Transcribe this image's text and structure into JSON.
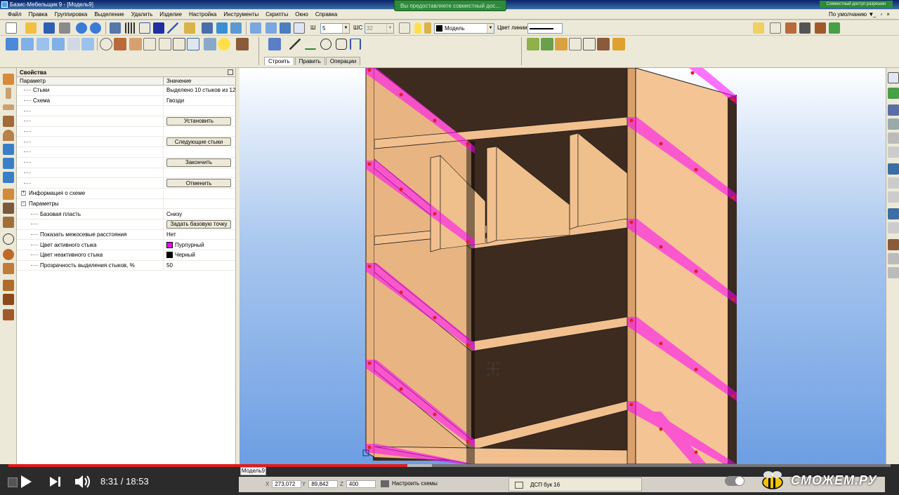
{
  "window": {
    "title": "Базис-Мебельщик 9 - [Модель9]",
    "share_banner": "Вы предоставляете совместный дос...",
    "share_right": "Совместный доступ разрешен",
    "profile": "По умолчанию",
    "profile_caret": "▼",
    "controls": [
      "_",
      "▫",
      "×"
    ]
  },
  "menu": [
    "Файл",
    "Правка",
    "Группировка",
    "Выделение",
    "Удалить",
    "Изделие",
    "Настройка",
    "Инструменты",
    "Скрипты",
    "Окно",
    "Справка"
  ],
  "toolbar": {
    "w_label": "Ш",
    "w_value": "5",
    "ws_label": "ШС",
    "ws_value": "32",
    "layer_name": "Модель",
    "line_color_label": "Цвет линии"
  },
  "mode_tabs": [
    "Строить",
    "Править",
    "Операции"
  ],
  "properties": {
    "title": "Свойства",
    "col_param": "Параметр",
    "col_value": "Значение",
    "rows": [
      {
        "name": "Стыки",
        "value": "Выделено 10 стыков из 12"
      },
      {
        "name": "Схема",
        "value": "Гвозди"
      }
    ],
    "buttons": {
      "set": "Установить",
      "next": "Следующие стыки",
      "finish": "Закончить",
      "cancel": "Отменить"
    },
    "scheme_info": "Информация о схеме",
    "params_group": "Параметры",
    "params": {
      "base_layer_name": "Базовая пласть",
      "base_layer_value": "Снизу",
      "base_point_button": "Задать базовую точку",
      "show_dist_name": "Показать межосевые расстояния",
      "show_dist_value": "Нет",
      "active_color_name": "Цвет активного стыка",
      "active_color_value": "Пурпурный",
      "inactive_color_name": "Цвет неактивного стыка",
      "inactive_color_value": "Черный",
      "transparency_name": "Прозрачность выделения стыков, %",
      "transparency_value": "50"
    },
    "expander_plus": "+",
    "expander_minus": "−"
  },
  "colors": {
    "active_joint": "#ff00ff",
    "inactive_joint": "#000000",
    "wood_light": "#f2c08e",
    "wood_dark": "#3d2a1e"
  },
  "viewport_tab": "Модель9",
  "status": {
    "x_label": "X",
    "x_value": "273,072",
    "y_label": "Y",
    "y_value": "89,842",
    "z_label": "Z",
    "z_value": "400",
    "scheme_settings": "Настроить схемы",
    "material": "ДСП бук 16"
  },
  "player": {
    "time": "8:31 / 18:53",
    "progress": 0.452,
    "buffered": 0.48,
    "watermark": "СМОЖЕМ.РУ"
  }
}
